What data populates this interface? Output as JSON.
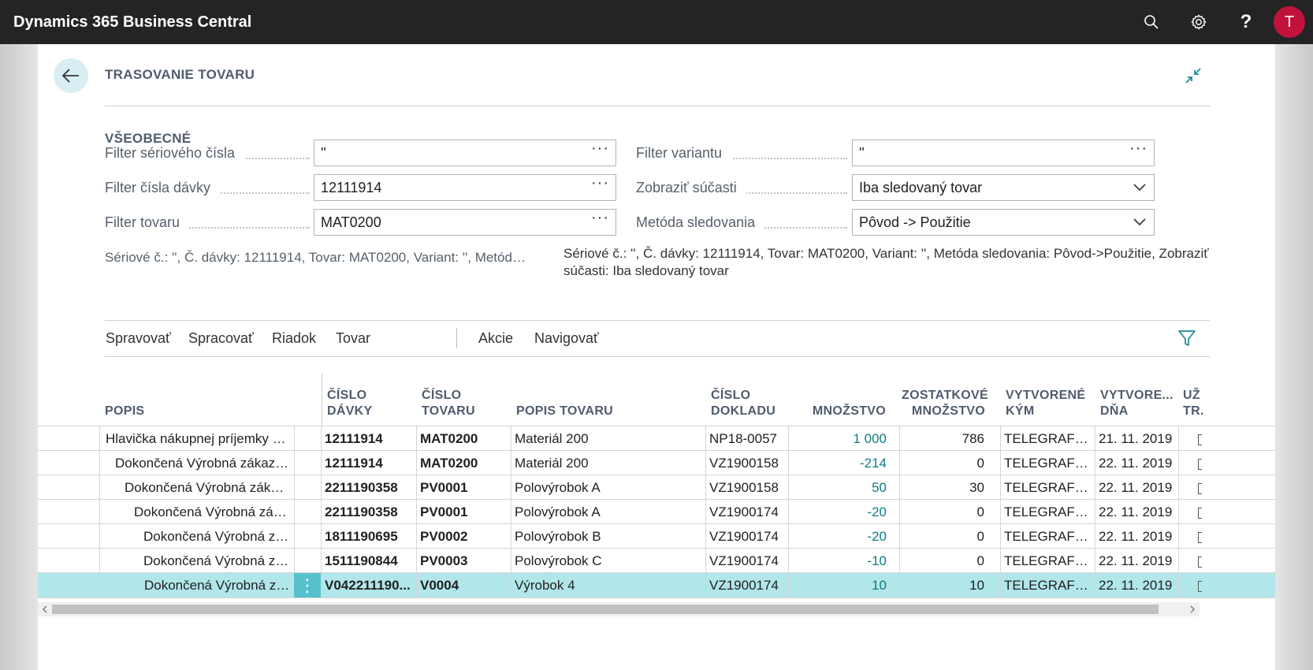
{
  "app": {
    "title": "Dynamics 365 Business Central",
    "user_initial": "T"
  },
  "header_icons": [
    "search-icon",
    "gear-icon",
    "help-icon"
  ],
  "page": {
    "title": "TRASOVANIE TOVARU"
  },
  "general": {
    "section_title": "VŠEOBECNÉ",
    "serial_filter": {
      "label": "Filter sériového čísla",
      "value": "''"
    },
    "lot_filter": {
      "label": "Filter čísla dávky",
      "value": "12111914"
    },
    "item_filter": {
      "label": "Filter tovaru",
      "value": "MAT0200"
    },
    "variant_filter": {
      "label": "Filter variantu",
      "value": "''"
    },
    "show_components": {
      "label": "Zobraziť súčasti",
      "value": "Iba sledovaný tovar"
    },
    "trace_method": {
      "label": "Metóda sledovania",
      "value": "Pôvod -> Použitie"
    },
    "summary_left": "Sériové č.: '', Č. dávky: 12111914, Tovar: MAT0200, Variant: '', Metóda sle...",
    "summary_right": "Sériové č.: '', Č. dávky: 12111914, Tovar: MAT0200, Variant: '', Metóda sledovania: Pôvod->Použitie, Zobraziť súčasti: Iba sledovaný tovar"
  },
  "actions": {
    "manage": "Spravovať",
    "process": "Spracovať",
    "line": "Riadok",
    "item": "Tovar",
    "actions": "Akcie",
    "navigate": "Navigovať"
  },
  "columns": {
    "description": "POPIS",
    "lot_no_1": "ČÍSLO",
    "lot_no_2": "DÁVKY",
    "item_no_1": "ČÍSLO",
    "item_no_2": "TOVARU",
    "item_desc": "POPIS TOVARU",
    "doc_no_1": "ČÍSLO",
    "doc_no_2": "DOKLADU",
    "quantity": "MNOŽSTVO",
    "remaining_1": "ZOSTATKOVÉ",
    "remaining_2": "MNOŽSTVO",
    "created_by_1": "VYTVORENÉ",
    "created_by_2": "KÝM",
    "created_on_1": "VYTVORE...",
    "created_on_2": "DŇA",
    "user_1": "UŽ",
    "user_2": "TR."
  },
  "rows": [
    {
      "description": "Hlavička nákupnej príjemky NP...",
      "lot": "12111914",
      "item": "MAT0200",
      "item_desc": "Materiál 200",
      "doc": "NP18-0057",
      "qty": "1 000",
      "remaining": "786",
      "created_by": "TELEGRAFIA\\...",
      "created_on": "21. 11. 2019",
      "selected": false
    },
    {
      "description": "Dokončená Výrobná zákazka ...",
      "lot": "12111914",
      "item": "MAT0200",
      "item_desc": "Materiál 200",
      "doc": "VZ1900158",
      "qty": "-214",
      "remaining": "0",
      "created_by": "TELEGRAFIA\\...",
      "created_on": "22. 11. 2019",
      "selected": false
    },
    {
      "description": "Dokončená Výrobná zákazk...",
      "lot": "2211190358",
      "item": "PV0001",
      "item_desc": "Polovýrobok A",
      "doc": "VZ1900158",
      "qty": "50",
      "remaining": "30",
      "created_by": "TELEGRAFIA\\...",
      "created_on": "22. 11. 2019",
      "selected": false
    },
    {
      "description": "Dokončená Výrobná záka...",
      "lot": "2211190358",
      "item": "PV0001",
      "item_desc": "Polovýrobok A",
      "doc": "VZ1900174",
      "qty": "-20",
      "remaining": "0",
      "created_by": "TELEGRAFIA\\...",
      "created_on": "22. 11. 2019",
      "selected": false
    },
    {
      "description": "Dokončená Výrobná zák...",
      "lot": "1811190695",
      "item": "PV0002",
      "item_desc": "Polovýrobok B",
      "doc": "VZ1900174",
      "qty": "-20",
      "remaining": "0",
      "created_by": "TELEGRAFIA\\...",
      "created_on": "22. 11. 2019",
      "selected": false
    },
    {
      "description": "Dokončená Výrobná zák...",
      "lot": "1511190844",
      "item": "PV0003",
      "item_desc": "Polovýrobok C",
      "doc": "VZ1900174",
      "qty": "-10",
      "remaining": "0",
      "created_by": "TELEGRAFIA\\...",
      "created_on": "22. 11. 2019",
      "selected": false
    },
    {
      "description": "Dokončená Výrobná zák...",
      "lot": "V042211190...",
      "item": "V0004",
      "item_desc": "Výrobok 4",
      "doc": "VZ1900174",
      "qty": "10",
      "remaining": "10",
      "created_by": "TELEGRAFIA\\...",
      "created_on": "22. 11. 2019",
      "selected": true
    }
  ]
}
